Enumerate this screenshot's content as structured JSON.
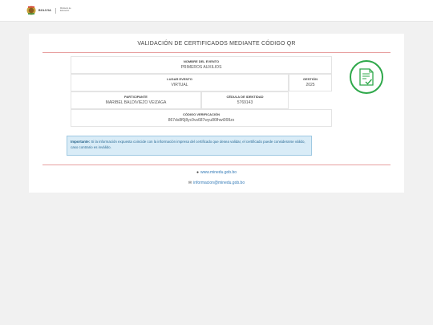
{
  "header": {
    "logo_title": "BOLIVIA",
    "logo_subtitle": "Ministerio de Educación"
  },
  "page": {
    "title": "VALIDACIÓN DE CERTIFICADOS MEDIANTE CÓDIGO QR"
  },
  "certificate": {
    "evento_label": "NOMBRE DEL EVENTO",
    "evento_value": "PRIMEROS AUXILIOS",
    "lugar_label": "LUGAR EVENTO",
    "lugar_value": "VIRTUAL",
    "gestion_label": "GESTIÓN",
    "gestion_value": "2025",
    "participante_label": "PARTICIPANTE",
    "participante_value": "MARIBEL BALDIVIEZO VEIZAGA",
    "cedula_label": "CÉDULA DE IDENTIDAD",
    "cedula_value": "5769143",
    "codigo_label": "CÓDIGO VERIFICACIÓN",
    "codigo_value": "867ds8f0j8yc9vs687wyu86fhwt999zx"
  },
  "alert": {
    "strong": "Importante:",
    "text": " Si la información expuesta coincide con la información impresa del certificado que desea validar, el certificado puede considerarse válido, caso contrario es inválido."
  },
  "footer": {
    "website": "www.minedu.gob.bo",
    "email": "informacion@minedu.gob.bo"
  },
  "colors": {
    "accent_green": "#2ea84a",
    "rule_red": "#e8a0a0",
    "link_blue": "#337ab7",
    "alert_bg": "#d9ecf7"
  },
  "icons": [
    "bolivia-seal-icon",
    "certificate-check-icon",
    "globe-icon",
    "envelope-icon"
  ]
}
